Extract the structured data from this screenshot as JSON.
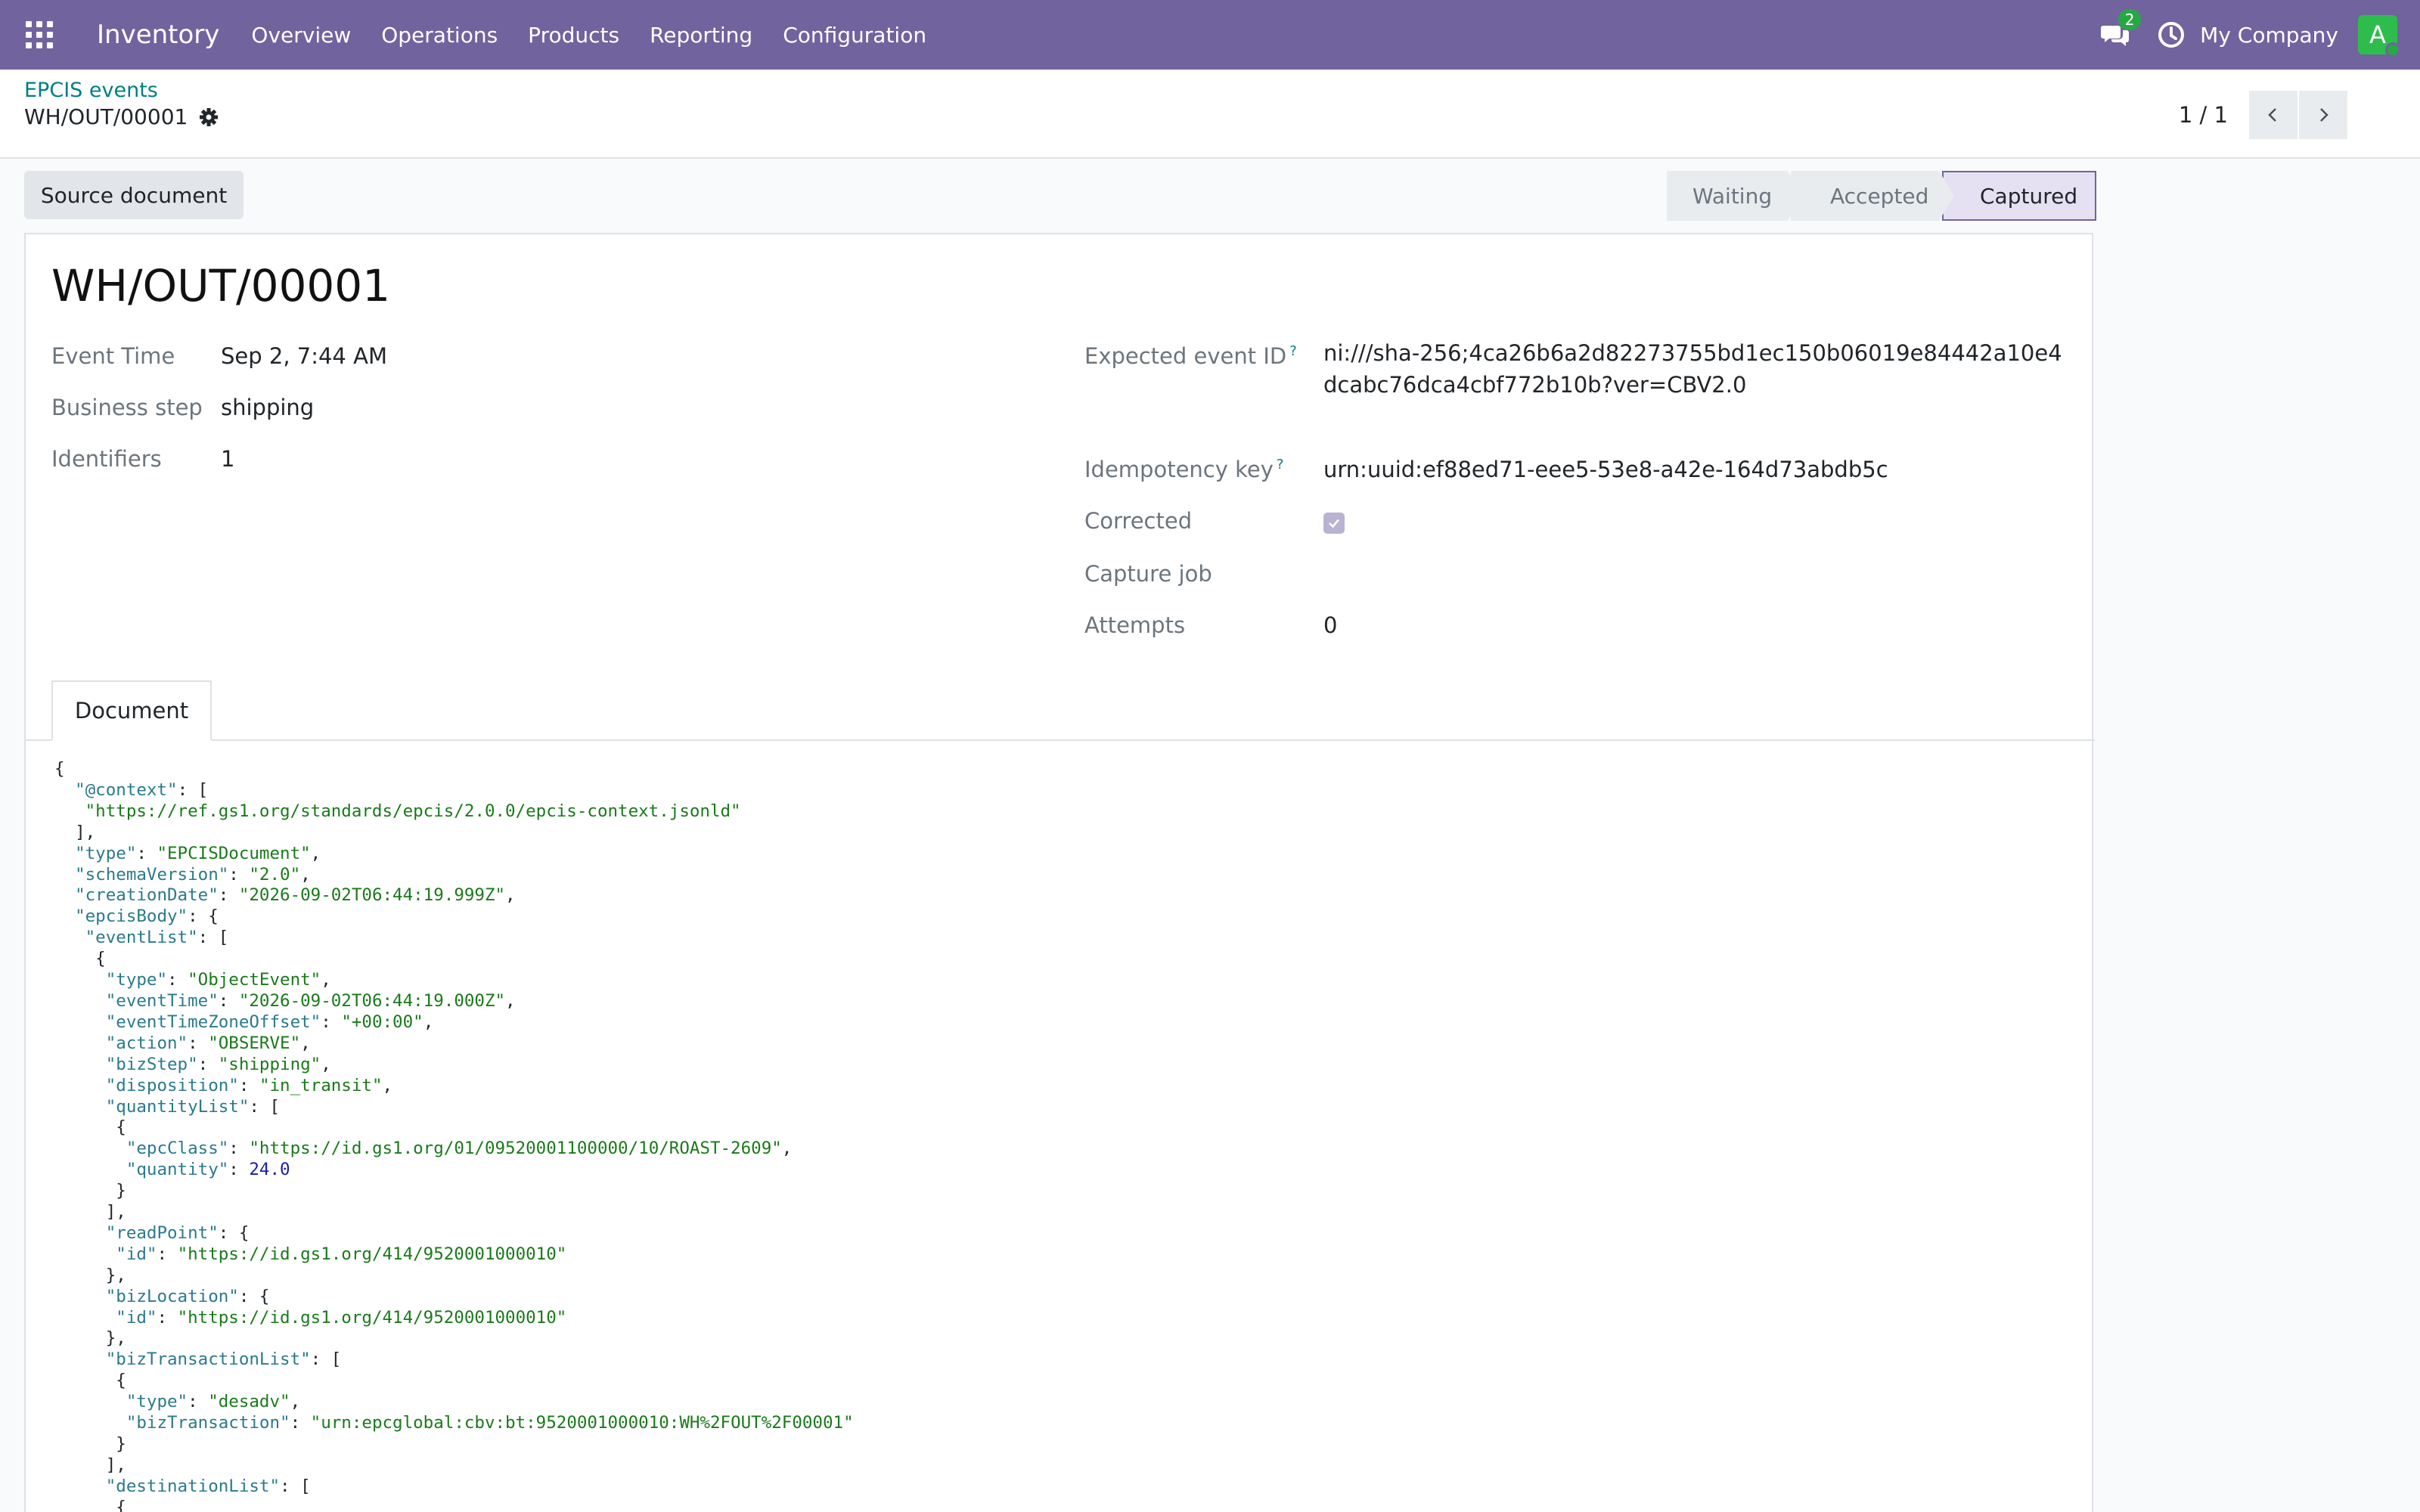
{
  "app": {
    "name": "Inventory"
  },
  "nav": {
    "items": [
      "Overview",
      "Operations",
      "Products",
      "Reporting",
      "Configuration"
    ]
  },
  "topbar": {
    "messages_count": "2",
    "company": "My Company",
    "avatar_letter": "A"
  },
  "breadcrumb": {
    "parent": "EPCIS events",
    "current": "WH/OUT/00001"
  },
  "pager": {
    "value": "1 / 1"
  },
  "buttons": {
    "source_document": "Source document"
  },
  "statusbar": {
    "stages": [
      "Waiting",
      "Accepted",
      "Captured"
    ],
    "current": "Captured"
  },
  "record": {
    "title": "WH/OUT/00001",
    "event_time_label": "Event Time",
    "event_time": "Sep 2, 7:44 AM",
    "business_step_label": "Business step",
    "business_step": "shipping",
    "identifiers_label": "Identifiers",
    "identifiers": "1",
    "expected_event_id_label": "Expected event ID",
    "expected_event_id": "ni:///sha-256;4ca26b6a2d82273755bd1ec150b06019e84442a10e4dcabc76dca4cbf772b10b?ver=CBV2.0",
    "idempotency_key_label": "Idempotency key",
    "idempotency_key": "urn:uuid:ef88ed71-eee5-53e8-a42e-164d73abdb5c",
    "corrected_label": "Corrected",
    "corrected": true,
    "capture_job_label": "Capture job",
    "capture_job": "",
    "attempts_label": "Attempts",
    "attempts": "0",
    "help_marker": "?"
  },
  "tabs": {
    "document": "Document"
  },
  "document_lines": [
    [
      [
        "p",
        "{"
      ]
    ],
    [
      [
        "p",
        "  "
      ],
      [
        "k",
        "\"@context\""
      ],
      [
        "p",
        ": ["
      ]
    ],
    [
      [
        "p",
        "   "
      ],
      [
        "s",
        "\"https://ref.gs1.org/standards/epcis/2.0.0/epcis-context.jsonld\""
      ]
    ],
    [
      [
        "p",
        "  ],"
      ]
    ],
    [
      [
        "p",
        "  "
      ],
      [
        "k",
        "\"type\""
      ],
      [
        "p",
        ": "
      ],
      [
        "s",
        "\"EPCISDocument\""
      ],
      [
        "p",
        ","
      ]
    ],
    [
      [
        "p",
        "  "
      ],
      [
        "k",
        "\"schemaVersion\""
      ],
      [
        "p",
        ": "
      ],
      [
        "s",
        "\"2.0\""
      ],
      [
        "p",
        ","
      ]
    ],
    [
      [
        "p",
        "  "
      ],
      [
        "k",
        "\"creationDate\""
      ],
      [
        "p",
        ": "
      ],
      [
        "s",
        "\"2026-09-02T06:44:19.999Z\""
      ],
      [
        "p",
        ","
      ]
    ],
    [
      [
        "p",
        "  "
      ],
      [
        "k",
        "\"epcisBody\""
      ],
      [
        "p",
        ": {"
      ]
    ],
    [
      [
        "p",
        "   "
      ],
      [
        "k",
        "\"eventList\""
      ],
      [
        "p",
        ": ["
      ]
    ],
    [
      [
        "p",
        "    {"
      ]
    ],
    [
      [
        "p",
        "     "
      ],
      [
        "k",
        "\"type\""
      ],
      [
        "p",
        ": "
      ],
      [
        "s",
        "\"ObjectEvent\""
      ],
      [
        "p",
        ","
      ]
    ],
    [
      [
        "p",
        "     "
      ],
      [
        "k",
        "\"eventTime\""
      ],
      [
        "p",
        ": "
      ],
      [
        "s",
        "\"2026-09-02T06:44:19.000Z\""
      ],
      [
        "p",
        ","
      ]
    ],
    [
      [
        "p",
        "     "
      ],
      [
        "k",
        "\"eventTimeZoneOffset\""
      ],
      [
        "p",
        ": "
      ],
      [
        "s",
        "\"+00:00\""
      ],
      [
        "p",
        ","
      ]
    ],
    [
      [
        "p",
        "     "
      ],
      [
        "k",
        "\"action\""
      ],
      [
        "p",
        ": "
      ],
      [
        "s",
        "\"OBSERVE\""
      ],
      [
        "p",
        ","
      ]
    ],
    [
      [
        "p",
        "     "
      ],
      [
        "k",
        "\"bizStep\""
      ],
      [
        "p",
        ": "
      ],
      [
        "s",
        "\"shipping\""
      ],
      [
        "p",
        ","
      ]
    ],
    [
      [
        "p",
        "     "
      ],
      [
        "k",
        "\"disposition\""
      ],
      [
        "p",
        ": "
      ],
      [
        "s",
        "\"in_transit\""
      ],
      [
        "p",
        ","
      ]
    ],
    [
      [
        "p",
        "     "
      ],
      [
        "k",
        "\"quantityList\""
      ],
      [
        "p",
        ": ["
      ]
    ],
    [
      [
        "p",
        "      {"
      ]
    ],
    [
      [
        "p",
        "       "
      ],
      [
        "k",
        "\"epcClass\""
      ],
      [
        "p",
        ": "
      ],
      [
        "s",
        "\"https://id.gs1.org/01/09520001100000/10/ROAST-2609\""
      ],
      [
        "p",
        ","
      ]
    ],
    [
      [
        "p",
        "       "
      ],
      [
        "k",
        "\"quantity\""
      ],
      [
        "p",
        ": "
      ],
      [
        "n",
        "24.0"
      ]
    ],
    [
      [
        "p",
        "      }"
      ]
    ],
    [
      [
        "p",
        "     ],"
      ]
    ],
    [
      [
        "p",
        "     "
      ],
      [
        "k",
        "\"readPoint\""
      ],
      [
        "p",
        ": {"
      ]
    ],
    [
      [
        "p",
        "      "
      ],
      [
        "k",
        "\"id\""
      ],
      [
        "p",
        ": "
      ],
      [
        "s",
        "\"https://id.gs1.org/414/9520001000010\""
      ]
    ],
    [
      [
        "p",
        "     },"
      ]
    ],
    [
      [
        "p",
        "     "
      ],
      [
        "k",
        "\"bizLocation\""
      ],
      [
        "p",
        ": {"
      ]
    ],
    [
      [
        "p",
        "      "
      ],
      [
        "k",
        "\"id\""
      ],
      [
        "p",
        ": "
      ],
      [
        "s",
        "\"https://id.gs1.org/414/9520001000010\""
      ]
    ],
    [
      [
        "p",
        "     },"
      ]
    ],
    [
      [
        "p",
        "     "
      ],
      [
        "k",
        "\"bizTransactionList\""
      ],
      [
        "p",
        ": ["
      ]
    ],
    [
      [
        "p",
        "      {"
      ]
    ],
    [
      [
        "p",
        "       "
      ],
      [
        "k",
        "\"type\""
      ],
      [
        "p",
        ": "
      ],
      [
        "s",
        "\"desadv\""
      ],
      [
        "p",
        ","
      ]
    ],
    [
      [
        "p",
        "       "
      ],
      [
        "k",
        "\"bizTransaction\""
      ],
      [
        "p",
        ": "
      ],
      [
        "s",
        "\"urn:epcglobal:cbv:bt:9520001000010:WH%2FOUT%2F00001\""
      ]
    ],
    [
      [
        "p",
        "      }"
      ]
    ],
    [
      [
        "p",
        "     ],"
      ]
    ],
    [
      [
        "p",
        "     "
      ],
      [
        "k",
        "\"destinationList\""
      ],
      [
        "p",
        ": ["
      ]
    ],
    [
      [
        "p",
        "      {"
      ]
    ]
  ],
  "colors": {
    "brand": "#71639e",
    "accent": "#017e84",
    "success": "#28a745"
  }
}
